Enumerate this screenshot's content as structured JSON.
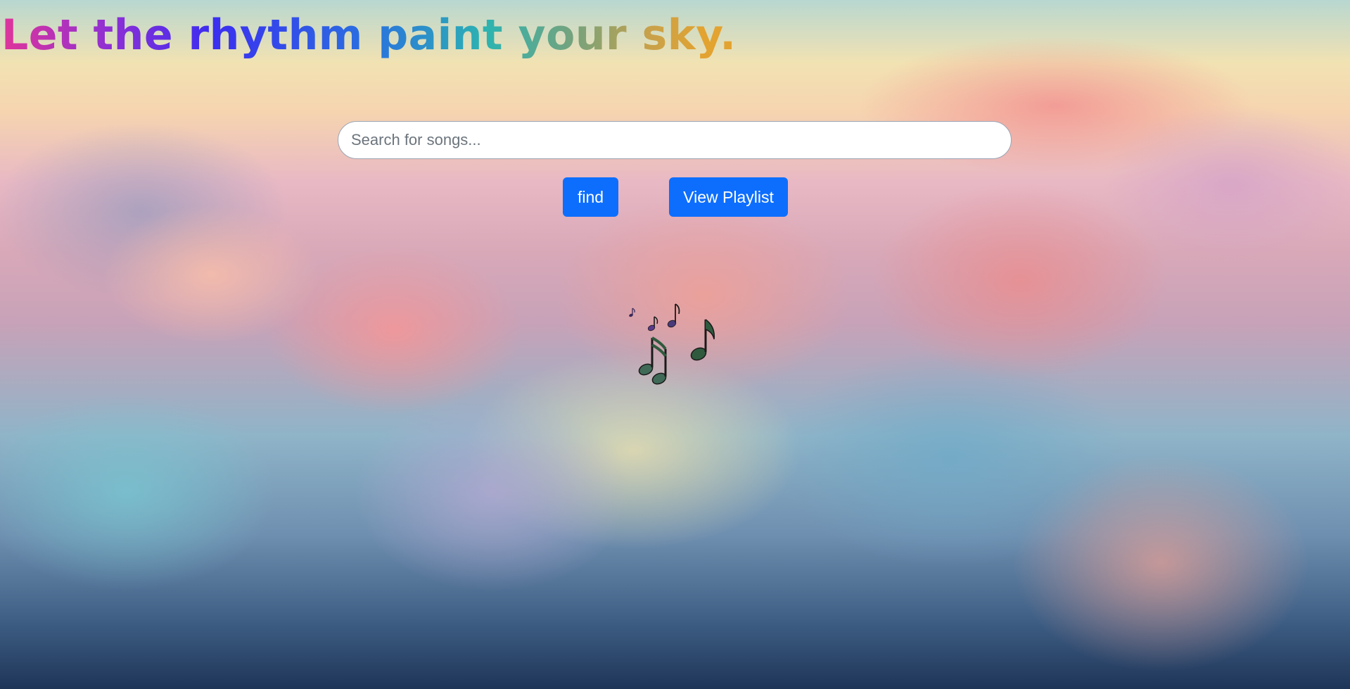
{
  "page": {
    "title": "Let the rhythm paint your sky."
  },
  "search": {
    "placeholder": "Search for songs...",
    "value": ""
  },
  "buttons": {
    "find_label": "find",
    "playlist_label": "View Playlist"
  },
  "colors": {
    "button_blue": "#0d6efd",
    "title_gradient": [
      "#e0359a",
      "#8b2fd6",
      "#3b2ef0",
      "#2a70e0",
      "#2db3b0",
      "#7aa27a",
      "#c8a14a",
      "#e3a330"
    ],
    "note_green": "#2f5a3e",
    "note_dark": "#1a1a1a"
  },
  "decoration": {
    "icon": "music-notes-icon"
  }
}
